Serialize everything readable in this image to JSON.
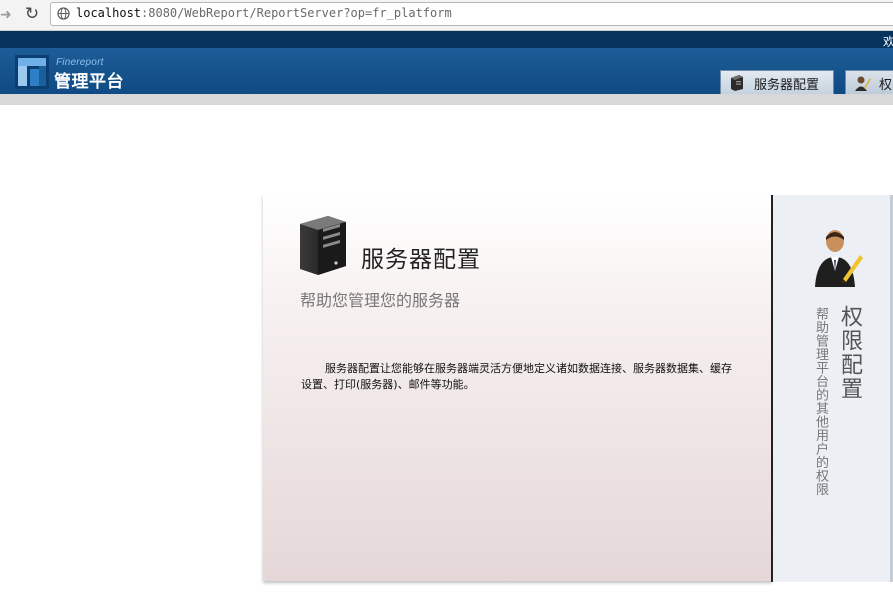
{
  "browser": {
    "url_host": "localhost",
    "url_rest": ":8080/WebReport/ReportServer?op=fr_platform"
  },
  "header": {
    "welcome_text": "欢",
    "logo_small": "Finereport",
    "logo_title": "管理平台",
    "tabs": [
      {
        "label": "服务器配置",
        "icon": "server-icon"
      },
      {
        "label": "权",
        "icon": "user-icon"
      }
    ]
  },
  "card": {
    "title": "服务器配置",
    "subtitle": "帮助您管理您的服务器",
    "description": "服务器配置让您能够在服务器端灵活方便地定义诸如数据连接、服务器数据集、缓存设置、打印(服务器)、邮件等功能。"
  },
  "permission_panel": {
    "title": "权限配置",
    "subtitle": "帮助管理平台的其他用户的权限"
  },
  "colors": {
    "header_dark": "#06325e",
    "header_blue": "#1d5d97",
    "card_bottom": "#e5d7d8",
    "panel_bg": "#ecf0f4"
  }
}
